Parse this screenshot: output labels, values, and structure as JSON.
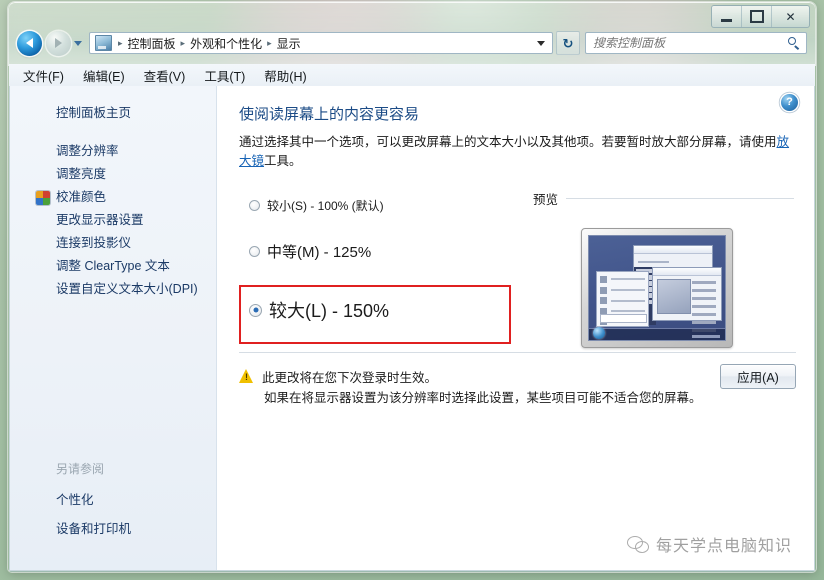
{
  "window": {
    "controls": {
      "minimize": "minimize-button",
      "maximize": "maximize-button",
      "close": "close-button",
      "close_glyph": "✕"
    }
  },
  "nav": {
    "back": "back-button",
    "forward": "forward-button",
    "history_dropdown": "history-dropdown",
    "breadcrumb": {
      "items": [
        "控制面板",
        "外观和个性化",
        "显示"
      ],
      "separator": "▸"
    },
    "refresh_glyph": "↻",
    "search": {
      "placeholder": "搜索控制面板",
      "value": ""
    }
  },
  "menubar": {
    "items": [
      "文件(F)",
      "编辑(E)",
      "查看(V)",
      "工具(T)",
      "帮助(H)"
    ]
  },
  "sidebar": {
    "home": "控制面板主页",
    "links": [
      {
        "label": "调整分辨率",
        "icon": ""
      },
      {
        "label": "调整亮度",
        "icon": ""
      },
      {
        "label": "校准颜色",
        "icon": "shield-icon"
      },
      {
        "label": "更改显示器设置",
        "icon": ""
      },
      {
        "label": "连接到投影仪",
        "icon": ""
      },
      {
        "label": "调整 ClearType 文本",
        "icon": ""
      },
      {
        "label": "设置自定义文本大小(DPI)",
        "icon": ""
      }
    ],
    "see_also_title": "另请参阅",
    "see_also": [
      "个性化",
      "设备和打印机"
    ]
  },
  "main": {
    "heading": "使阅读屏幕上的内容更容易",
    "desc_part1": "通过选择其中一个选项，可以更改屏幕上的文本大小以及其他项。若要暂时放大部分屏幕，请使用",
    "desc_link": "放大镜",
    "desc_part2": "工具。",
    "options": [
      {
        "label": "较小(S) - 100% (默认)",
        "selected": false
      },
      {
        "label": "中等(M) - 125%",
        "selected": false
      },
      {
        "label": "较大(L) - 150%",
        "selected": true
      }
    ],
    "highlight_color": "#e02020",
    "preview_label": "预览",
    "note_line1": "此更改将在您下次登录时生效。",
    "note_line2": "如果在将显示器设置为该分辨率时选择此设置，某些项目可能不适合您的屏幕。",
    "apply_label": "应用(A)"
  },
  "watermark": {
    "text": "每天学点电脑知识"
  }
}
